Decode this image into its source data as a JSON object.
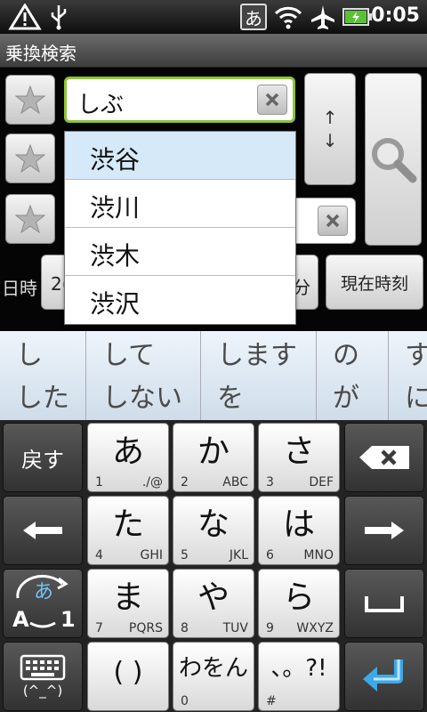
{
  "status": {
    "ime_indicator": "あ",
    "time": "0:05"
  },
  "app": {
    "title": "乗換検索",
    "from_field": {
      "value": "しぶ"
    },
    "swap": {
      "up": "↑",
      "down": "↓"
    },
    "datetime_label": "日時",
    "date_partial": "2(",
    "minute_label": "分",
    "now_button": "現在時刻",
    "suggestions": [
      "渋谷",
      "渋川",
      "渋木",
      "渋沢"
    ]
  },
  "candidates": [
    {
      "line1": "し",
      "line2": "した"
    },
    {
      "line1": "して",
      "line2": "しない"
    },
    {
      "line1": "しますを",
      "line2": "を"
    },
    {
      "line1": "の",
      "line2": "が"
    },
    {
      "line1": "す",
      "line2": "に"
    }
  ],
  "keyboard": {
    "back": "戻す",
    "emoji": "(^_^)",
    "mode_hira": "あ",
    "mode_alpha": "A",
    "mode_num": "1",
    "keys": [
      {
        "main": "あ",
        "sub_l": "1",
        "sub_r": "./@"
      },
      {
        "main": "か",
        "sub_l": "2",
        "sub_r": "ABC"
      },
      {
        "main": "さ",
        "sub_l": "3",
        "sub_r": "DEF"
      },
      {
        "main": "た",
        "sub_l": "4",
        "sub_r": "GHI"
      },
      {
        "main": "な",
        "sub_l": "5",
        "sub_r": "JKL"
      },
      {
        "main": "は",
        "sub_l": "6",
        "sub_r": "MNO"
      },
      {
        "main": "ま",
        "sub_l": "7",
        "sub_r": "PQRS"
      },
      {
        "main": "や",
        "sub_l": "8",
        "sub_r": "TUV"
      },
      {
        "main": "ら",
        "sub_l": "9",
        "sub_r": "WXYZ"
      },
      {
        "main": "( )",
        "sub_l": "",
        "sub_r": ""
      },
      {
        "main": "わをん",
        "sub_l": "0",
        "sub_r": ""
      },
      {
        "main": "、。?!",
        "sub_l": "#",
        "sub_r": ""
      }
    ]
  },
  "colors": {
    "accent_green": "#8fc33c",
    "selected_row": "#d6e9f8",
    "enter_blue": "#3fa8e6"
  }
}
